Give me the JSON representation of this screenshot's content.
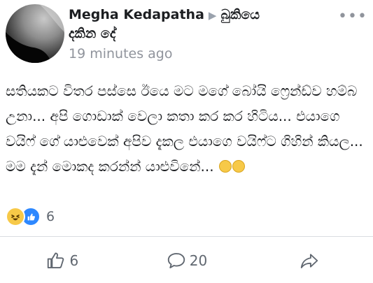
{
  "post": {
    "author": "Megha Kedapatha",
    "group_name_part1": "බුකියෙ",
    "group_name_part2": "දකින දේ",
    "timestamp": "19 minutes ago",
    "body": "සතියකට විතර පස්සෙ ඊයෙ මට මගේ බෝයි ෆ්‍රෙන්ඩ්ව හම්බ උනා... අපි ගොඩාක් වෙලා කතා කර කර හිටිය... එයාගෙ වයිෆ් ගේ යාළුවෙක් අපිව දැකල එයාගෙ වයිෆ්ට ගිහින් කියල... මම දැන් මොකද කරන්න් යාළුවිනේ...",
    "reactions_count": "6",
    "likes": "6",
    "comments": "20"
  },
  "icons": {
    "avatar": "profile-photo",
    "arrow": "triangle-right-icon",
    "more": "more-options-icon",
    "haha": "haha-emoji-icon",
    "like": "like-thumb-icon",
    "comment": "comment-bubble-icon",
    "share": "share-arrow-icon"
  },
  "colors": {
    "secondary_text": "#90949c",
    "like_blue": "#2d88ff",
    "haha_yellow": "#f7c948"
  }
}
